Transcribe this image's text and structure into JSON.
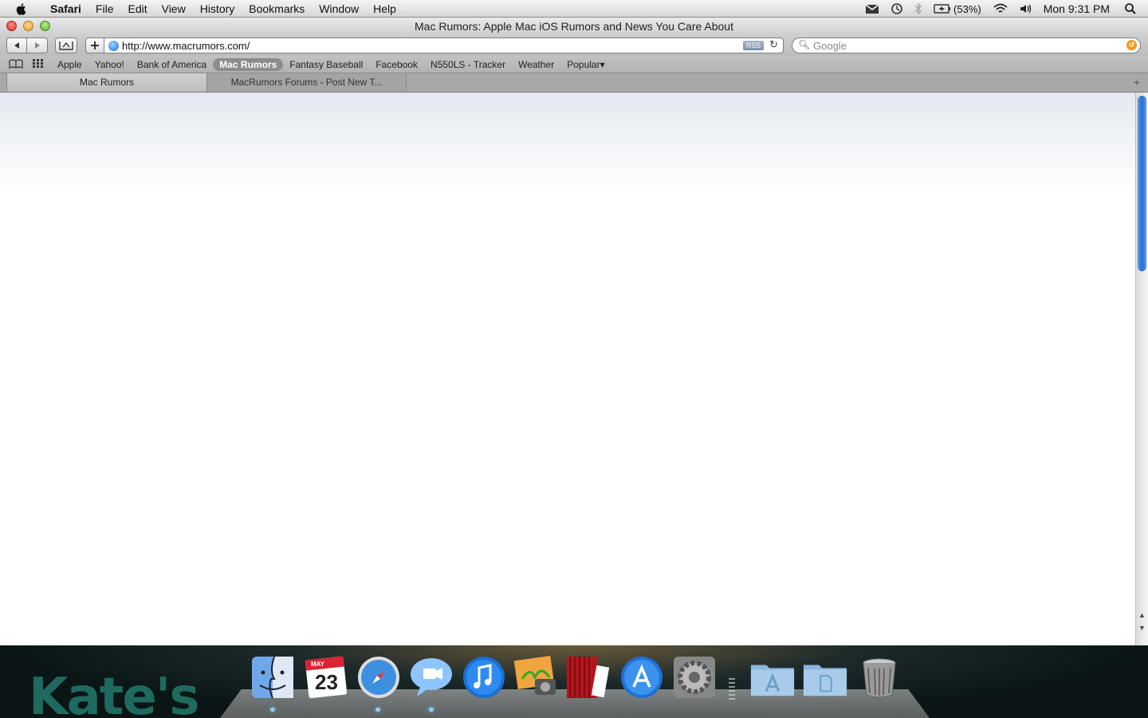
{
  "menubar": {
    "app_name": "Safari",
    "menus": [
      "File",
      "Edit",
      "View",
      "History",
      "Bookmarks",
      "Window",
      "Help"
    ],
    "battery": "(53%)",
    "clock": "Mon 9:31 PM"
  },
  "window": {
    "title": "Mac Rumors: Apple Mac iOS Rumors and News You Care About"
  },
  "toolbar": {
    "url": "http://www.macrumors.com/",
    "rss_label": "RSS",
    "search_placeholder": "Google"
  },
  "bookmarks": {
    "items": [
      "Apple",
      "Yahoo!",
      "Bank of America",
      "Mac Rumors",
      "Fantasy Baseball",
      "Facebook",
      "N550LS - Tracker",
      "Weather",
      "Popular▾"
    ],
    "active_index": 3
  },
  "tabs": [
    {
      "label": "Mac Rumors",
      "active": true
    },
    {
      "label": "MacRumors Forums - Post New T...",
      "active": false
    }
  ],
  "dock": {
    "calendar_month": "MAY",
    "calendar_day": "23",
    "wallpaper_text": "Kate's",
    "apps": [
      "finder-icon",
      "ical-icon",
      "safari-icon",
      "ichat-icon",
      "itunes-icon",
      "iphoto-icon",
      "photo-booth-icon",
      "app-store-icon",
      "system-preferences-icon",
      "applications-folder-icon",
      "documents-folder-icon",
      "trash-icon"
    ]
  },
  "colors": {
    "accent_blue": "#2a6fd0",
    "active_bookmark": "#8c8c8c",
    "snapback_orange": "#f19a1a"
  }
}
